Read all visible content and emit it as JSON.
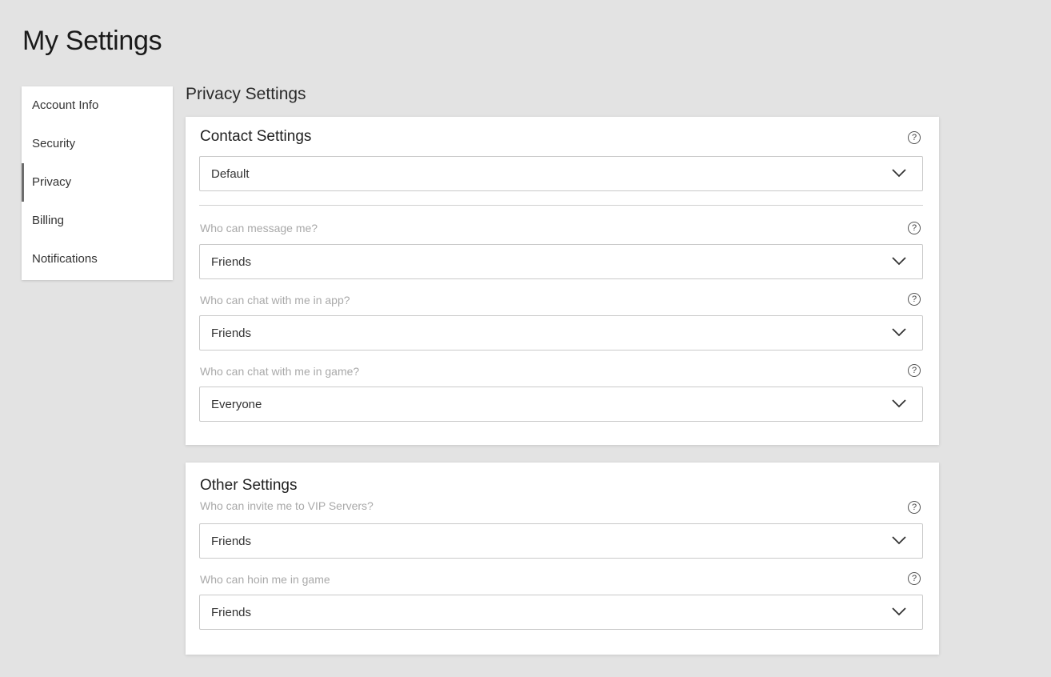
{
  "page": {
    "title": "My Settings"
  },
  "sidebar": {
    "items": [
      {
        "label": "Account Info"
      },
      {
        "label": "Security"
      },
      {
        "label": "Privacy",
        "active": true
      },
      {
        "label": "Billing"
      },
      {
        "label": "Notifications"
      }
    ]
  },
  "main": {
    "heading": "Privacy Settings",
    "contact": {
      "title": "Contact Settings",
      "help": "?",
      "preset": {
        "value": "Default"
      },
      "fields": [
        {
          "label": "Who can message me?",
          "value": "Friends",
          "help": "?"
        },
        {
          "label": "Who can chat with me in app?",
          "value": "Friends",
          "help": "?"
        },
        {
          "label": "Who can chat with me in game?",
          "value": "Everyone",
          "help": "?"
        }
      ]
    },
    "other": {
      "title": "Other Settings",
      "fields": [
        {
          "label": "Who can invite me to VIP Servers?",
          "value": "Friends",
          "help": "?"
        },
        {
          "label": "Who can hoin me in game",
          "value": "Friends",
          "help": "?"
        }
      ]
    }
  },
  "icons": {
    "help": "help-circle-icon",
    "chevron": "chevron-down-icon"
  }
}
